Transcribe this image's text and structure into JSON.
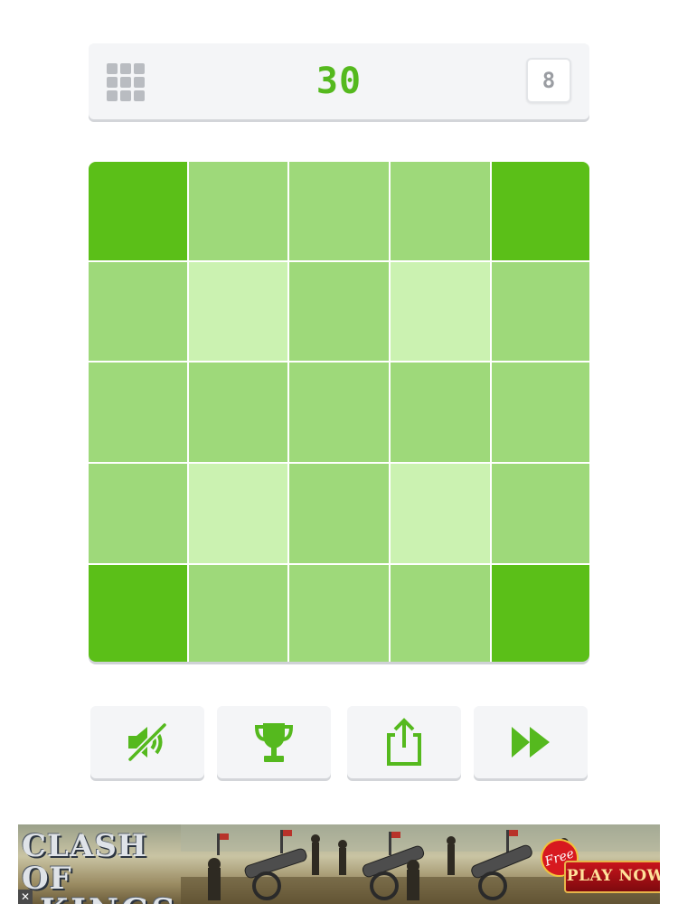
{
  "header": {
    "score": "30",
    "level": "8",
    "menu_icon": "grid-menu-icon"
  },
  "board": {
    "rows": 5,
    "cols": 5,
    "colors": {
      "dark": "#5bbf18",
      "mid": "#9ed97a",
      "light": "#cbf2b1"
    },
    "tiles": [
      [
        "dark",
        "mid",
        "mid",
        "mid",
        "dark"
      ],
      [
        "mid",
        "light",
        "mid",
        "light",
        "mid"
      ],
      [
        "mid",
        "mid",
        "mid",
        "mid",
        "mid"
      ],
      [
        "mid",
        "light",
        "mid",
        "light",
        "mid"
      ],
      [
        "dark",
        "mid",
        "mid",
        "mid",
        "dark"
      ]
    ]
  },
  "controls": [
    {
      "name": "mute-button",
      "icon": "sound-muted-icon"
    },
    {
      "name": "leaderboard-button",
      "icon": "trophy-icon"
    },
    {
      "name": "share-button",
      "icon": "share-icon"
    },
    {
      "name": "skip-button",
      "icon": "fast-forward-icon"
    }
  ],
  "ad": {
    "logo_line1": "CLASH OF",
    "logo_line2": "KINGS",
    "badge": "Free",
    "cta": "PLAY NOW",
    "close_label": "✕"
  },
  "theme": {
    "accent": "#55b91e",
    "panel": "#f4f5f7"
  }
}
